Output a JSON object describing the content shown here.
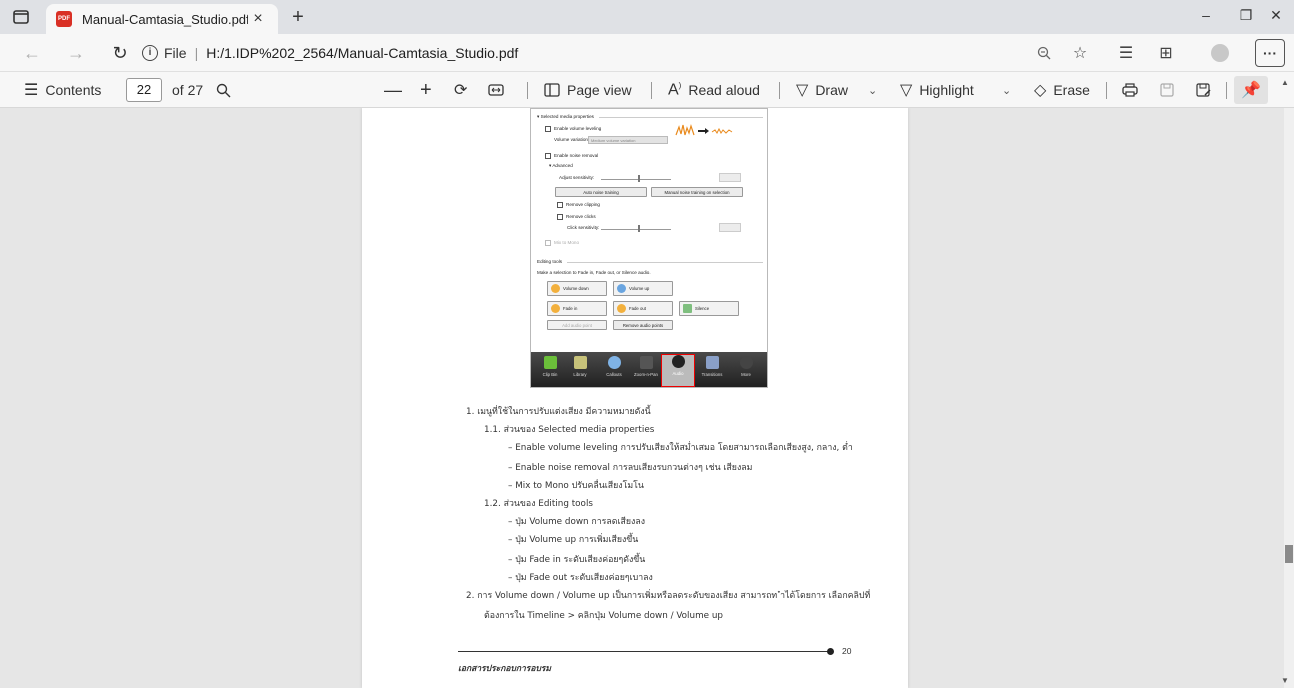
{
  "tab": {
    "title": "Manual-Camtasia_Studio.pdf",
    "close": "×",
    "new": "+"
  },
  "window": {
    "minimize": "–",
    "restore": "❐",
    "close": "✕"
  },
  "address": {
    "scheme": "File",
    "separator": "|",
    "url": "H:/1.IDP%202_2564/Manual-Camtasia_Studio.pdf"
  },
  "toolbar": {
    "contents": "Contents",
    "page_current": "22",
    "page_of": "of 27",
    "page_view": "Page view",
    "read_aloud": "Read aloud",
    "draw": "Draw",
    "highlight": "Highlight",
    "erase": "Erase"
  },
  "figure": {
    "section1": "Selected media properties",
    "enable_volume_leveling": "Enable volume leveling",
    "volume_variation_label": "Volume variation:",
    "volume_variation_value": "Medium volume variation",
    "enable_noise_removal": "Enable noise removal",
    "advanced": "Advanced",
    "adjust_sensitivity": "Adjust sensitivity:",
    "auto_noise_training": "Auto noise training",
    "manual_noise_training": "Manual noise training on selection",
    "remove_clipping": "Remove clipping",
    "remove_clicks": "Remove clicks",
    "click_sensitivity": "Click sensitivity:",
    "mix_to_mono": "Mix to Mono",
    "section2": "Editing tools",
    "editing_hint": "Make a selection to Fade in, Fade out, or Silence audio.",
    "volume_down": "Volume down",
    "volume_up": "Volume up",
    "fade_in": "Fade in",
    "fade_out": "Fade out",
    "silence": "Silence",
    "add_audio_point": "Add audio point",
    "remove_audio_points": "Remove audio points",
    "dock": [
      "Clip Bin",
      "Library",
      "Callouts",
      "Zoom-n-Pan",
      "Audio",
      "Transitions",
      "More"
    ]
  },
  "content": {
    "l1": "1.  เมนูที่ใช้ในการปรับแต่งเสียง มีความหมายดังนี้",
    "l2": "1.1.  ส่วนของ Selected media properties",
    "l3": "–   Enable volume leveling การปรับเสียงให้สม่ำเสมอ โดยสามารถเลือกเสียงสูง, กลาง, ต่ำ",
    "l4": "–   Enable noise removal การลบเสียงรบกวนต่างๆ เช่น เสียงลม",
    "l5": "–   Mix to Mono ปรับคลื่นเสียงโมโน",
    "l6": "1.2.  ส่วนของ Editing tools",
    "l7": "–   ปุ่ม Volume down การลดเสียงลง",
    "l8": "–   ปุ่ม Volume up การเพิ่มเสียงขึ้น",
    "l9": "–   ปุ่ม Fade in ระดับเสียงค่อยๆดังขึ้น",
    "l10": "–   ปุ่ม Fade out ระดับเสียงค่อยๆเบาลง",
    "l11": "2.  การ Volume down / Volume up เป็นการเพิ่มหรือลดระดับของเสียง สามารถท ำได้โดยการ เลือกคลิปที่",
    "l12": "ต้องการใน Timeline > คลิกปุ่ม Volume down / Volume up",
    "page_number": "20",
    "footer": "เอกสารประกอบการอบรม"
  },
  "colors": {
    "highlight_border": "#e00000",
    "pdf_icon": "#d93025"
  }
}
